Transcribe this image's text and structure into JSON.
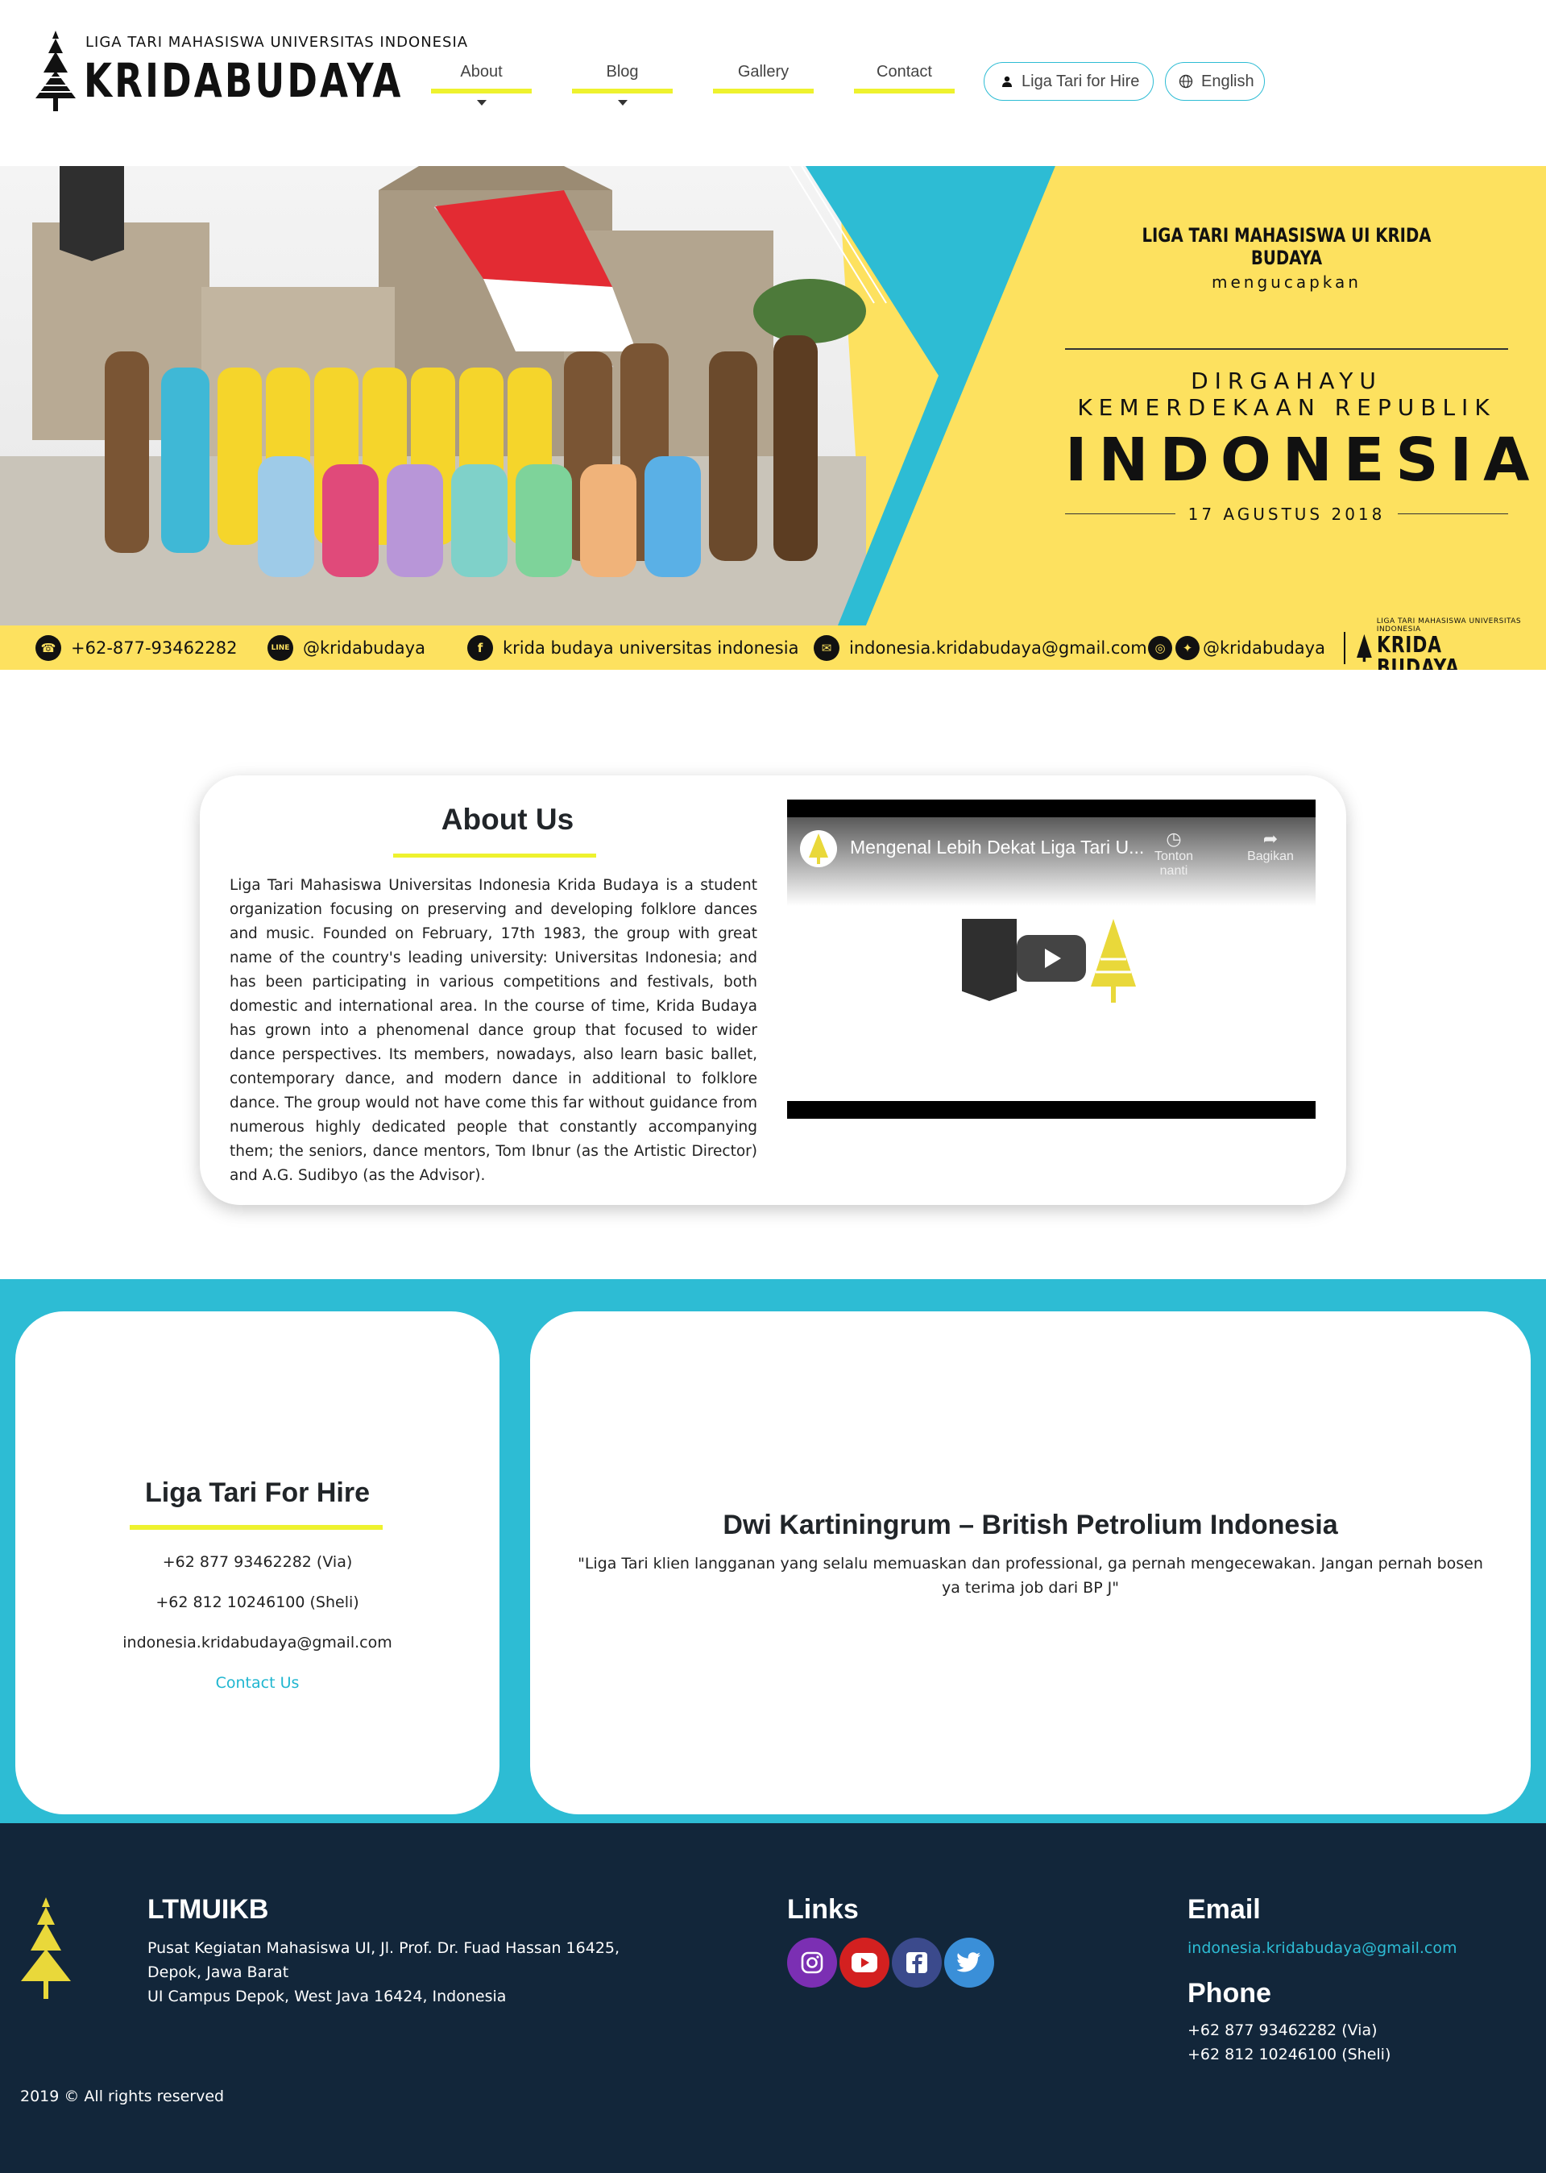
{
  "brand": {
    "subtitle": "LIGA TARI MAHASISWA UNIVERSITAS INDONESIA",
    "name": "KRIDABUDAYA"
  },
  "nav": {
    "items": [
      {
        "label": "About",
        "has_dropdown": true
      },
      {
        "label": "Blog",
        "has_dropdown": true
      },
      {
        "label": "Gallery",
        "has_dropdown": false
      },
      {
        "label": "Contact",
        "has_dropdown": false
      }
    ],
    "hire_label": "Liga Tari for Hire",
    "language_label": "English"
  },
  "banner": {
    "line1": "LIGA TARI MAHASISWA UI KRIDA BUDAYA",
    "line2": "mengucapkan",
    "line3": "DIRGAHAYU KEMERDEKAAN REPUBLIK",
    "line4": "INDONESIA",
    "date": "17 AGUSTUS 2018",
    "strip": {
      "phone": "+62-877-93462282",
      "line": "@kridabudaya",
      "facebook": "krida budaya universitas indonesia",
      "email": "indonesia.kridabudaya@gmail.com",
      "social": "@kridabudaya",
      "brand_sub": "LIGA TARI MAHASISWA UNIVERSITAS INDONESIA",
      "brand_main": "KRIDA BUDAYA"
    }
  },
  "about": {
    "title": "About Us",
    "text": "Liga Tari Mahasiswa Universitas Indonesia Krida Budaya is a student organization focusing on preserving and developing folklore dances and music. Founded on February, 17th 1983, the group with great name of the country's leading university: Universitas Indonesia; and has been participating in various competitions and festivals, both domestic and international area. In the course of time, Krida Budaya has grown into a phenomenal dance group that focused to wider dance perspectives. Its members, nowadays, also learn basic ballet, contemporary dance, and modern dance in additional to folklore dance. The group would not have come this far without guidance from numerous highly dedicated people that constantly accompanying them; the seniors, dance mentors, Tom Ibnur (as the Artistic Director) and A.G. Sudibyo (as the Advisor).",
    "video": {
      "title": "Mengenal Lebih Dekat Liga Tari U...",
      "watch_later": "Tonton nanti",
      "share": "Bagikan"
    }
  },
  "hire": {
    "title": "Liga Tari For Hire",
    "phone1": "+62 877 93462282 (Via)",
    "phone2": "+62 812 10246100 (Sheli)",
    "email": "indonesia.kridabudaya@gmail.com",
    "contact_link": "Contact Us"
  },
  "testimonial": {
    "name": "Dwi Kartiningrum – British Petrolium Indonesia",
    "quote": "\"Liga Tari klien langganan yang selalu memuaskan dan professional, ga pernah mengecewakan. Jangan pernah bosen ya terima job dari BP J\""
  },
  "footer": {
    "org_title": "LTMUIKB",
    "address1": "Pusat Kegiatan Mahasiswa UI, Jl. Prof. Dr. Fuad Hassan 16425,",
    "address2": "Depok, Jawa Barat",
    "address3": "UI Campus Depok, West Java 16424, Indonesia",
    "links_title": "Links",
    "social": [
      {
        "name": "instagram-icon",
        "color": "#7b2fb3"
      },
      {
        "name": "youtube-icon",
        "color": "#d32020"
      },
      {
        "name": "facebook-icon",
        "color": "#3b4a8c"
      },
      {
        "name": "twitter-icon",
        "color": "#3a8fd8"
      }
    ],
    "email_title": "Email",
    "email": "indonesia.kridabudaya@gmail.com",
    "phone_title": "Phone",
    "phone1": "+62 877 93462282 (Via)",
    "phone2": "+62 812 10246100 (Sheli)",
    "copyright": "2019 © All rights reserved"
  },
  "colors": {
    "accent_yellow": "#eef22e",
    "banner_yellow": "#fde15f",
    "teal": "#2dbcd4",
    "footer_navy": "#12263a"
  }
}
